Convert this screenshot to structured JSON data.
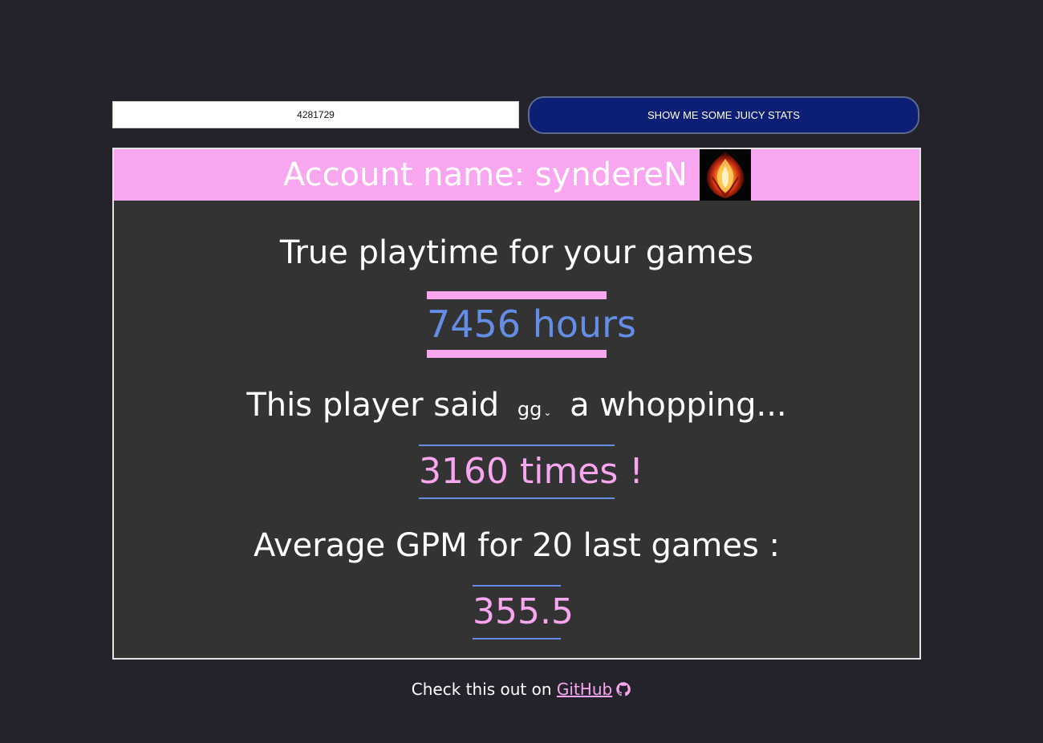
{
  "search": {
    "account_id": "4281729",
    "button_label": "SHOW ME SOME JUICY STATS"
  },
  "card": {
    "account_name_label": "Account name: syndereN",
    "avatar_icon": "red-flame-avatar-icon",
    "playtime_label": "True playtime for your games",
    "playtime_value": "7456 hours",
    "phrase_prefix": "This player said",
    "phrase_selected": "gg",
    "phrase_suffix": "a whopping...",
    "phrase_count": "3160 times !",
    "gpm_label": "Average GPM for 20 last games :",
    "gpm_value": "355.5"
  },
  "footer": {
    "text": "Check this out on",
    "link_label": "GitHub",
    "icon": "github-icon"
  },
  "colors": {
    "background": "#24232b",
    "card": "#333333",
    "accent_pink": "#f8a6ef",
    "accent_blue": "#648de6",
    "button": "#0d1e75"
  }
}
